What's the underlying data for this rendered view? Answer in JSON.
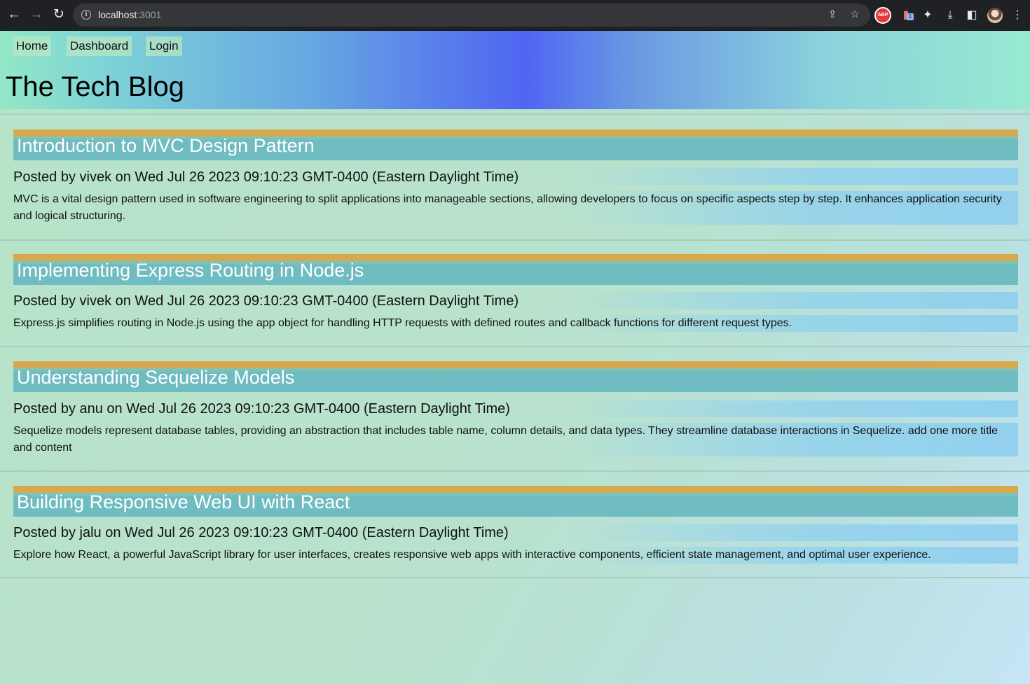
{
  "browser": {
    "url_host": "localhost",
    "url_port": ":3001",
    "icons": {
      "back": "back-arrow-icon",
      "forward": "forward-arrow-icon",
      "reload": "reload-icon",
      "info": "info-icon",
      "share": "share-icon",
      "bookmark": "star-icon",
      "adblock": "abp-icon",
      "cast": "cast-extension-icon",
      "extensions": "puzzle-icon",
      "downloads": "download-icon",
      "side_panel": "side-panel-icon",
      "profile": "avatar",
      "menu": "kebab-menu-icon"
    },
    "adblock_label": "ABP",
    "cast_badge": "1"
  },
  "nav": {
    "home": "Home",
    "dashboard": "Dashboard",
    "login": "Login"
  },
  "site": {
    "title": "The Tech Blog"
  },
  "posts": [
    {
      "title": "Introduction to MVC Design Pattern",
      "meta": "Posted by vivek on Wed Jul 26 2023 09:10:23 GMT-0400 (Eastern Daylight Time)",
      "body": "MVC is a vital design pattern used in software engineering to split applications into manageable sections, allowing developers to focus on specific aspects step by step. It enhances application security and logical structuring."
    },
    {
      "title": "Implementing Express Routing in Node.js",
      "meta": "Posted by vivek on Wed Jul 26 2023 09:10:23 GMT-0400 (Eastern Daylight Time)",
      "body": "Express.js simplifies routing in Node.js using the app object for handling HTTP requests with defined routes and callback functions for different request types."
    },
    {
      "title": "Understanding Sequelize Models",
      "meta": "Posted by anu on Wed Jul 26 2023 09:10:23 GMT-0400 (Eastern Daylight Time)",
      "body": "Sequelize models represent database tables, providing an abstraction that includes table name, column details, and data types. They streamline database interactions in Sequelize. add one more title and content"
    },
    {
      "title": "Building Responsive Web UI with React",
      "meta": "Posted by jalu on Wed Jul 26 2023 09:10:23 GMT-0400 (Eastern Daylight Time)",
      "body": "Explore how React, a powerful JavaScript library for user interfaces, creates responsive web apps with interactive components, efficient state management, and optimal user experience."
    }
  ],
  "colors": {
    "post_title_bar": "#6fbcc3",
    "post_title_accent": "#d9a84a",
    "header_center": "#4f66f2"
  }
}
